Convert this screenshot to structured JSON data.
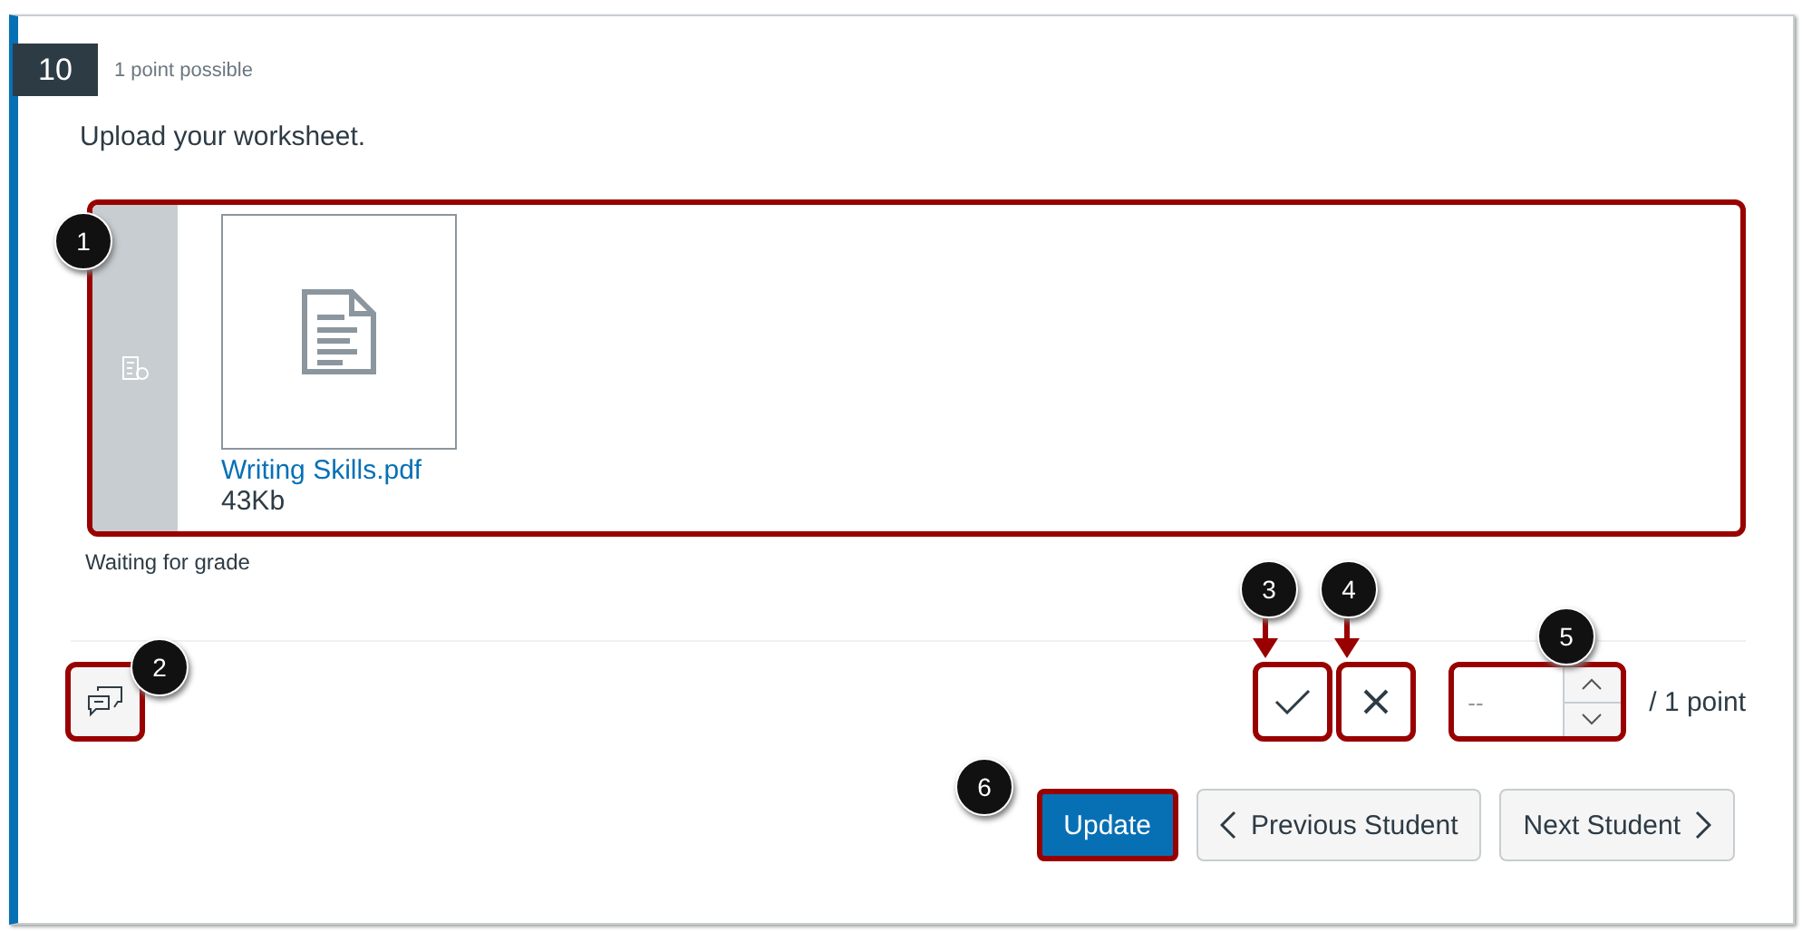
{
  "question": {
    "number": "10",
    "points": "1 point possible",
    "prompt": "Upload your worksheet."
  },
  "submission": {
    "file_name": "Writing Skills.pdf",
    "file_size": "43Kb",
    "status": "Waiting for grade",
    "callout": "1"
  },
  "comment_button": {
    "callout": "2"
  },
  "grading": {
    "correct_button": {
      "callout": "3"
    },
    "incorrect_button": {
      "callout": "4"
    },
    "score_field": {
      "placeholder": "--",
      "callout": "5"
    },
    "out_of": "/ 1 point"
  },
  "buttons": [
    {
      "kind": "primary",
      "label": "Update",
      "callout": "6"
    },
    {
      "kind": "previous",
      "label": "Previous Student"
    },
    {
      "kind": "next",
      "label": "Next Student"
    }
  ]
}
